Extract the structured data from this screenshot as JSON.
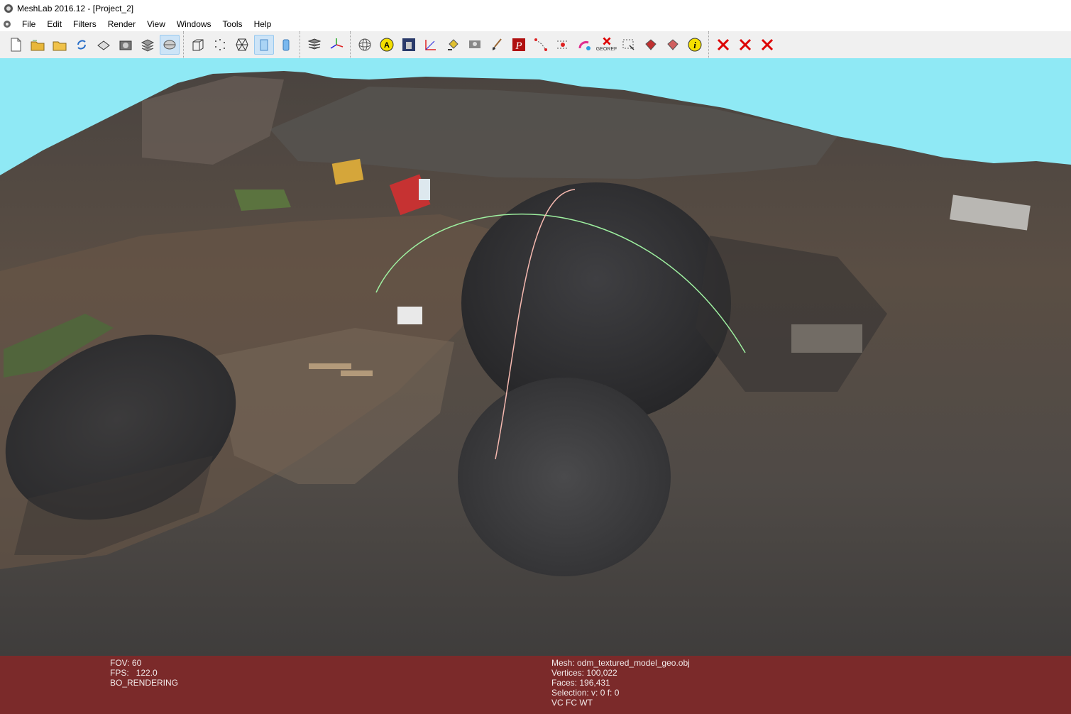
{
  "window": {
    "title": "MeshLab 2016.12 - [Project_2]"
  },
  "menu": [
    "File",
    "Edit",
    "Filters",
    "Render",
    "View",
    "Windows",
    "Tools",
    "Help"
  ],
  "toolbar": {
    "groups": [
      [
        "new-project-icon",
        "open-project-icon",
        "open-mesh-icon",
        "reload-icon",
        "save-icon",
        "snapshot-icon",
        "layers-icon",
        "mesh-layer-icon"
      ],
      [
        "bounding-box-icon",
        "points-icon",
        "wireframe-icon",
        "flat-shading-icon",
        "smooth-shading-icon"
      ],
      [
        "multi-layer-icon",
        "axis-icon"
      ],
      [
        "trackball-icon",
        "annotation-icon",
        "texture-icon",
        "measure-icon",
        "paint-bucket-icon",
        "camera-alignment-icon",
        "brush-icon",
        "point-picker-icon",
        "select-vertices-icon",
        "select-connected-icon",
        "paint-color-icon",
        "georef-icon",
        "select-faces-icon",
        "delete-faces-icon",
        "delete-vertices-icon",
        "info-icon"
      ],
      [
        "delete-selected-faces-icon",
        "delete-selected-vertices-icon",
        "delete-selection-icon"
      ]
    ],
    "georef_label": "GEOREF",
    "active": [
      "mesh-layer-icon",
      "flat-shading-icon"
    ]
  },
  "status": {
    "left": [
      "FOV: 60",
      "FPS:   122.0",
      "BO_RENDERING"
    ],
    "right": [
      "Mesh: odm_textured_model_geo.obj",
      "Vertices: 100,022",
      "Faces: 196,431",
      "Selection: v: 0 f: 0",
      "VC FC WT"
    ]
  },
  "colors": {
    "sky": "#8fe9f5",
    "status_bg": "#7b2a2a",
    "trackball_green": "#9ef0a0",
    "trackball_red": "#f6b9b0"
  }
}
